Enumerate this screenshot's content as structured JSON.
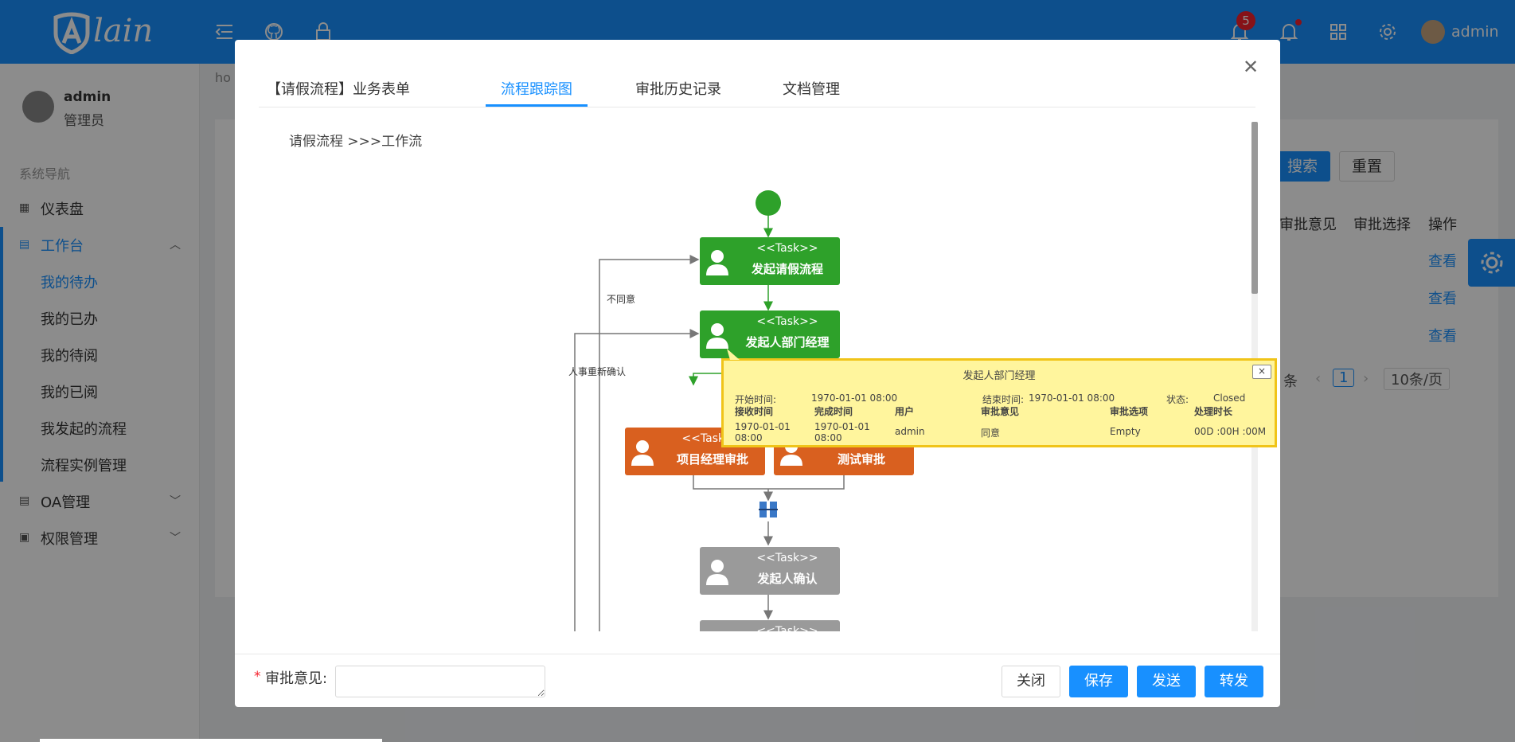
{
  "header": {
    "brand": "lain",
    "notification_count": "5",
    "username": "admin"
  },
  "sidebar": {
    "user_name": "admin",
    "user_role": "管理员",
    "group_title": "系统导航",
    "items": [
      {
        "label": "仪表盘",
        "icon": "dashboard-icon"
      },
      {
        "label": "工作台",
        "icon": "calendar-icon"
      },
      {
        "label": "OA管理",
        "icon": "calendar-icon"
      },
      {
        "label": "权限管理",
        "icon": "id-card-icon"
      }
    ],
    "workbench_items": [
      "我的待办",
      "我的已办",
      "我的待阅",
      "我的已阅",
      "我发起的流程",
      "流程实例管理"
    ]
  },
  "background_page": {
    "breadcrumb": "ho",
    "search_button": "搜索",
    "reset_button": "重置",
    "table_headers": [
      "审批意见",
      "审批选择",
      "操作"
    ],
    "row_actions": [
      "查看",
      "查看",
      "查看"
    ],
    "pagination": {
      "total_suffix": "条",
      "current_page": "1",
      "page_size": "10条/页"
    }
  },
  "modal": {
    "tabs": [
      "【请假流程】业务表单",
      "流程跟踪图",
      "审批历史记录",
      "文档管理"
    ],
    "active_tab": 1,
    "workflow_path": "请假流程 >>>工作流",
    "footer": {
      "opinion_label": "审批意见:",
      "required_mark": "*",
      "buttons": [
        "关闭",
        "保存",
        "发送",
        "转发"
      ]
    }
  },
  "diagram": {
    "nodes": [
      {
        "type": "<<Task>>",
        "name": "发起请假流程",
        "state": "done"
      },
      {
        "type": "<<Task>>",
        "name": "发起人部门经理",
        "state": "done"
      },
      {
        "type": "<<Task>>",
        "name": "项目经理审批",
        "state": "active"
      },
      {
        "type": "",
        "name": "测试审批",
        "state": "active"
      },
      {
        "type": "<<Task>>",
        "name": "发起人确认",
        "state": "pending"
      },
      {
        "type": "<<Task>>",
        "name": "",
        "state": "pending"
      }
    ],
    "edge_labels": [
      "不同意",
      "人事重新确认"
    ],
    "colors": {
      "done": "#2ea12a",
      "active": "#d9601f",
      "pending": "#9a9a9a"
    }
  },
  "tooltip": {
    "title": "发起人部门经理",
    "close": "×",
    "start_label": "开始时间:",
    "start_value": "1970-01-01 08:00",
    "end_label": "结束时间:",
    "end_value": "1970-01-01 08:00",
    "status_label": "状态:",
    "status_value": "Closed",
    "columns": [
      "接收时间",
      "完成时间",
      "用户",
      "审批意见",
      "审批选项",
      "处理时长"
    ],
    "row": {
      "receive_date": "1970-01-01",
      "receive_time": "08:00",
      "finish_date": "1970-01-01",
      "finish_time": "08:00",
      "user": "admin",
      "opinion": "同意",
      "option": "Empty",
      "duration": "00D :00H :00M"
    }
  }
}
